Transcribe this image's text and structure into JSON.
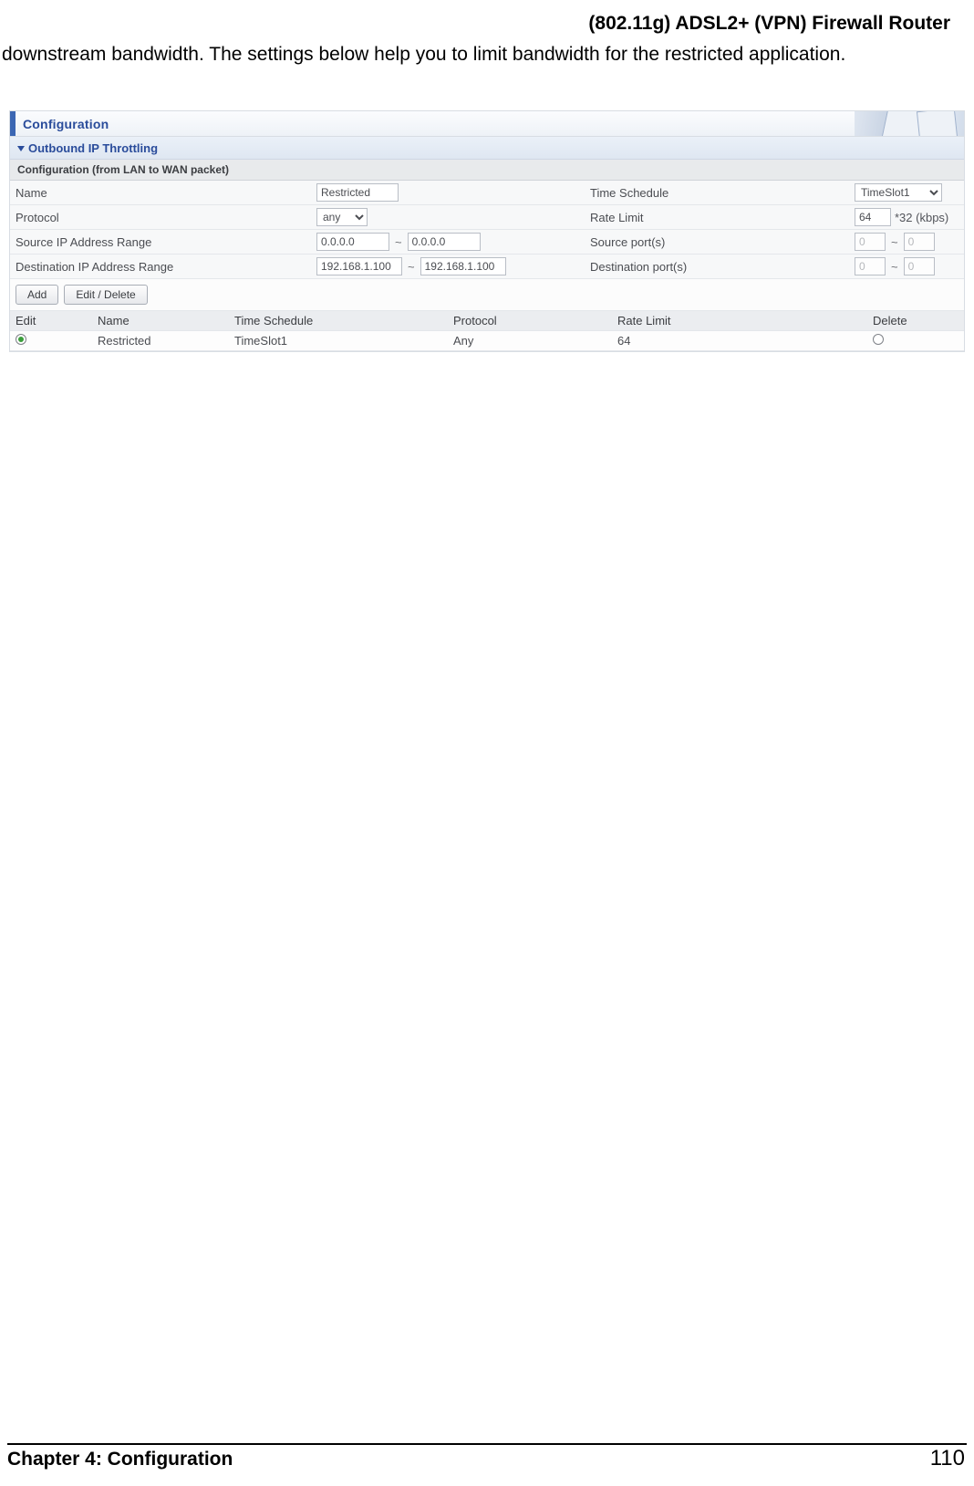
{
  "doc": {
    "title": "(802.11g) ADSL2+ (VPN) Firewall Router",
    "intro": "downstream bandwidth. The settings below help you to limit bandwidth for the restricted application.",
    "chapter": "Chapter 4: Configuration",
    "page_number": "110"
  },
  "panel": {
    "title": "Configuration",
    "section": "Outbound IP Throttling",
    "subsection": "Configuration (from LAN to WAN packet)",
    "labels": {
      "name": "Name",
      "time_schedule": "Time Schedule",
      "protocol": "Protocol",
      "rate_limit": "Rate Limit",
      "src_ip": "Source IP Address Range",
      "src_ports": "Source port(s)",
      "dst_ip": "Destination IP Address Range",
      "dst_ports": "Destination port(s)",
      "rate_unit": "*32 (kbps)",
      "range_sep": "~"
    },
    "values": {
      "name": "Restricted",
      "protocol": "any",
      "time_schedule": "TimeSlot1",
      "rate_limit": "64",
      "src_ip_from": "0.0.0.0",
      "src_ip_to": "0.0.0.0",
      "src_port_from": "0",
      "src_port_to": "0",
      "dst_ip_from": "192.168.1.100",
      "dst_ip_to": "192.168.1.100",
      "dst_port_from": "0",
      "dst_port_to": "0"
    },
    "buttons": {
      "add": "Add",
      "edit_delete": "Edit / Delete"
    },
    "grid": {
      "headers": {
        "edit": "Edit",
        "name": "Name",
        "time_schedule": "Time Schedule",
        "protocol": "Protocol",
        "rate_limit": "Rate Limit",
        "delete": "Delete"
      },
      "rows": [
        {
          "edit_checked": true,
          "name": "Restricted",
          "time_schedule": "TimeSlot1",
          "protocol": "Any",
          "rate_limit": "64",
          "delete_checked": false
        }
      ]
    }
  }
}
